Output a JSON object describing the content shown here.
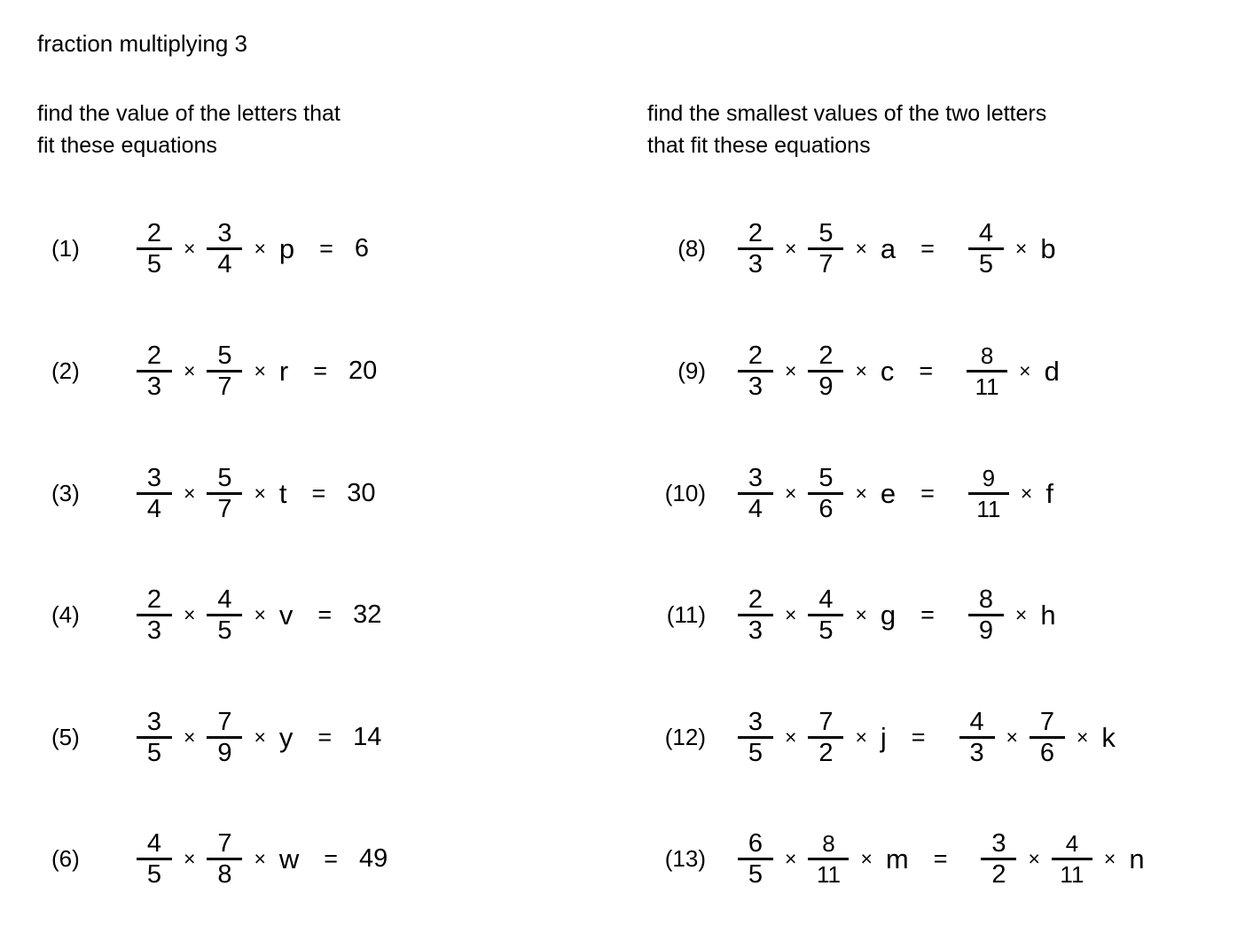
{
  "title": "fraction multiplying 3",
  "instructions": {
    "left": "find the value of the letters that\nfit these equations",
    "right": "find the smallest values of the two letters\nthat fit these equations"
  },
  "symbols": {
    "times": "×",
    "equals": "="
  },
  "left_column": [
    {
      "label": "(1)",
      "f1": {
        "n": "2",
        "d": "5"
      },
      "f2": {
        "n": "3",
        "d": "4"
      },
      "var": "p",
      "result": "6"
    },
    {
      "label": "(2)",
      "f1": {
        "n": "2",
        "d": "3"
      },
      "f2": {
        "n": "5",
        "d": "7"
      },
      "var": "r",
      "result": "20"
    },
    {
      "label": "(3)",
      "f1": {
        "n": "3",
        "d": "4"
      },
      "f2": {
        "n": "5",
        "d": "7"
      },
      "var": "t",
      "result": "30"
    },
    {
      "label": "(4)",
      "f1": {
        "n": "2",
        "d": "3"
      },
      "f2": {
        "n": "4",
        "d": "5"
      },
      "var": "v",
      "result": "32"
    },
    {
      "label": "(5)",
      "f1": {
        "n": "3",
        "d": "5"
      },
      "f2": {
        "n": "7",
        "d": "9"
      },
      "var": "y",
      "result": "14"
    },
    {
      "label": "(6)",
      "f1": {
        "n": "4",
        "d": "5"
      },
      "f2": {
        "n": "7",
        "d": "8"
      },
      "var": "w",
      "result": "49"
    }
  ],
  "right_column": [
    {
      "label": "(8)",
      "f1": {
        "n": "2",
        "d": "3"
      },
      "f2": {
        "n": "5",
        "d": "7"
      },
      "var": "a",
      "f3": {
        "n": "4",
        "d": "5"
      },
      "f4": null,
      "var2": "b"
    },
    {
      "label": "(9)",
      "f1": {
        "n": "2",
        "d": "3"
      },
      "f2": {
        "n": "2",
        "d": "9"
      },
      "var": "c",
      "f3": {
        "n": "8",
        "d": "11"
      },
      "f4": null,
      "var2": "d"
    },
    {
      "label": "(10)",
      "f1": {
        "n": "3",
        "d": "4"
      },
      "f2": {
        "n": "5",
        "d": "6"
      },
      "var": "e",
      "f3": {
        "n": "9",
        "d": "11"
      },
      "f4": null,
      "var2": "f"
    },
    {
      "label": "(11)",
      "f1": {
        "n": "2",
        "d": "3"
      },
      "f2": {
        "n": "4",
        "d": "5"
      },
      "var": "g",
      "f3": {
        "n": "8",
        "d": "9"
      },
      "f4": null,
      "var2": "h"
    },
    {
      "label": "(12)",
      "f1": {
        "n": "3",
        "d": "5"
      },
      "f2": {
        "n": "7",
        "d": "2"
      },
      "var": "j",
      "f3": {
        "n": "4",
        "d": "3"
      },
      "f4": {
        "n": "7",
        "d": "6"
      },
      "var2": "k"
    },
    {
      "label": "(13)",
      "f1": {
        "n": "6",
        "d": "5"
      },
      "f2": {
        "n": "8",
        "d": "11"
      },
      "var": "m",
      "f3": {
        "n": "3",
        "d": "2"
      },
      "f4": {
        "n": "4",
        "d": "11"
      },
      "var2": "n"
    }
  ]
}
